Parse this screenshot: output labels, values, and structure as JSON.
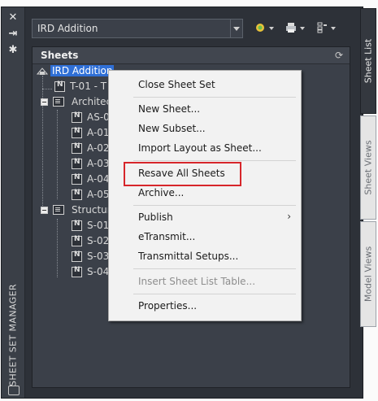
{
  "titlebar": {
    "vertical_title": "SHEET SET MANAGER",
    "close_glyph": "✕",
    "autohide_glyph": "⇥",
    "properties_glyph": "✱"
  },
  "toolbar": {
    "sheetset_value": "IRD Addition"
  },
  "panel": {
    "title": "Sheets",
    "refresh_glyph": "⟳"
  },
  "tree": {
    "root": "IRD Addition",
    "items": [
      {
        "label": "T-01 - T",
        "kind": "sheet"
      },
      {
        "label": "Architec",
        "kind": "subset"
      },
      {
        "label": "AS-0",
        "kind": "sheet"
      },
      {
        "label": "A-01",
        "kind": "sheet"
      },
      {
        "label": "A-02",
        "kind": "sheet"
      },
      {
        "label": "A-03",
        "kind": "sheet"
      },
      {
        "label": "A-04",
        "kind": "sheet"
      },
      {
        "label": "A-05",
        "kind": "sheet"
      },
      {
        "label": "Structur",
        "kind": "subset"
      },
      {
        "label": "S-01",
        "kind": "sheet"
      },
      {
        "label": "S-02",
        "kind": "sheet"
      },
      {
        "label": "S-03",
        "kind": "sheet"
      },
      {
        "label": "S-04",
        "kind": "sheet"
      }
    ]
  },
  "context_menu": {
    "items": [
      {
        "label": "Close Sheet Set",
        "enabled": true
      },
      {
        "label": "New Sheet...",
        "enabled": true
      },
      {
        "label": "New Subset...",
        "enabled": true
      },
      {
        "label": "Import Layout as Sheet...",
        "enabled": true
      },
      {
        "label": "Resave All Sheets",
        "enabled": true,
        "highlighted": true
      },
      {
        "label": "Archive...",
        "enabled": true
      },
      {
        "label": "Publish",
        "enabled": true,
        "submenu": true
      },
      {
        "label": "eTransmit...",
        "enabled": true
      },
      {
        "label": "Transmittal Setups...",
        "enabled": true
      },
      {
        "label": "Insert Sheet List Table...",
        "enabled": false
      },
      {
        "label": "Properties...",
        "enabled": true
      }
    ],
    "submenu_glyph": "›"
  },
  "tabs": [
    "Sheet List",
    "Sheet Views",
    "Model Views"
  ],
  "colors": {
    "palette_bg": "#2d3138",
    "selection": "#2f6fd6",
    "highlight_box": "#d7262b"
  }
}
